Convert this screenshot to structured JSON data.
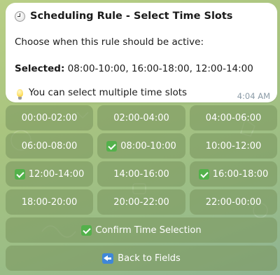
{
  "message": {
    "title": "Scheduling Rule - Select Time Slots",
    "prompt": "Choose when this rule should be active:",
    "selected_label": "Selected:",
    "selected_value": "08:00-10:00, 16:00-18:00, 12:00-14:00",
    "hint": "You can select multiple time slots",
    "time": "4:04 AM"
  },
  "keyboard": {
    "slots": [
      {
        "label": "00:00-02:00",
        "selected": false
      },
      {
        "label": "02:00-04:00",
        "selected": false
      },
      {
        "label": "04:00-06:00",
        "selected": false
      },
      {
        "label": "06:00-08:00",
        "selected": false
      },
      {
        "label": "08:00-10:00",
        "selected": true
      },
      {
        "label": "10:00-12:00",
        "selected": false
      },
      {
        "label": "12:00-14:00",
        "selected": true
      },
      {
        "label": "14:00-16:00",
        "selected": false
      },
      {
        "label": "16:00-18:00",
        "selected": true
      },
      {
        "label": "18:00-20:00",
        "selected": false
      },
      {
        "label": "20:00-22:00",
        "selected": false
      },
      {
        "label": "22:00-00:00",
        "selected": false
      }
    ],
    "confirm_label": "Confirm Time Selection",
    "back_label": "Back to Fields"
  }
}
